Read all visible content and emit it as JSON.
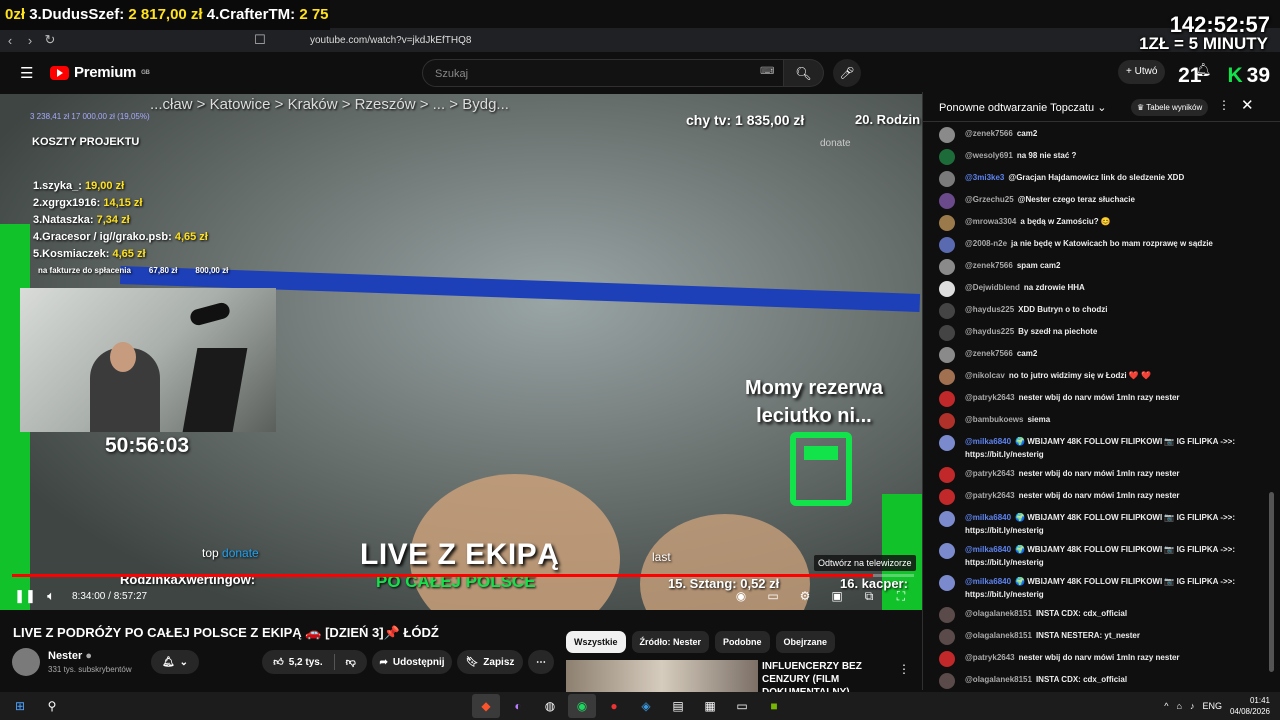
{
  "overlay": {
    "ticker_a": "0zł",
    "ticker_b": "3.DudusSzef:",
    "ticker_c": "2 817,00 zł",
    "ticker_d": "4.CrafterTM:",
    "ticker_e": "2 75",
    "timer": "142:52:57",
    "rate": "1ZŁ = 5 MINUTY",
    "counter_a": "21",
    "counter_b": "39"
  },
  "browser": {
    "url": "youtube.com/watch?v=jkdJkEfTHQ8"
  },
  "header": {
    "logo": "Premium",
    "logo_region": "GB",
    "search_placeholder": "Szukaj",
    "create_label": "Utwó"
  },
  "video": {
    "stream_head": "3 238,41 zł  17 000,00 zł (19,05%)",
    "route": "...cław > Katowice > Kraków > Rzeszów > ... > Bydg...",
    "tv_label": "chy tv: 1 835,00 zł",
    "rodzin": "20. Rodzin",
    "donate_top": "donate",
    "koszty": "KOSZTY PROJEKTU",
    "leaders": [
      {
        "name": "1.szyka_:",
        "amount": "19,00 zł"
      },
      {
        "name": "2.xgrgx1916:",
        "amount": "14,15 zł"
      },
      {
        "name": "3.Nataszka:",
        "amount": "7,34 zł"
      },
      {
        "name": "4.Gracesor / ig//grako.psb:",
        "amount": "4,65 zł"
      },
      {
        "name": "5.Kosmiaczek:",
        "amount": "4,65 zł"
      }
    ],
    "faktura": {
      "label": "na fakturze do spłacenia",
      "a": "67,80 zł",
      "b": "800,00 zł"
    },
    "webcam_clock": "50:56:03",
    "rezerwa": [
      "Momy rezerwa",
      "leciutko ni..."
    ],
    "live": "LIVE Z EKIPĄ",
    "polsce": "PO CAŁEJ POLSCE",
    "top_donate": "top",
    "top_donate_word": "donate",
    "last_donate": "last",
    "rodzinka": "RodzinkaXwertingów:",
    "sztang": "15. Sztang: 0,52 zł",
    "kacper": "16. kacper:",
    "tooltip": "Odtwórz na telewizorze",
    "time": "8:34:00 / 8:57:27",
    "progress": 0.955
  },
  "below": {
    "title": "LIVE Z PODRÓŻY PO CAŁEJ POLSCE Z EKIPĄ 🚗 [DZIEŃ 3]📌 ŁÓDŹ",
    "channel": "Nester",
    "subs": "331 tys. subskrybentów",
    "likes": "5,2 tys.",
    "share": "Udostępnij",
    "save": "Zapisz",
    "chips": [
      "Wszystkie",
      "Źródło: Nester",
      "Podobne",
      "Obejrzane"
    ],
    "related_title": "INFLUENCERZY BEZ CENZURY (FILM DOKUMENTALNY)"
  },
  "chat": {
    "title": "Ponowne odtwarzanie Topczatu",
    "badge": "Tabele wyników",
    "messages": [
      {
        "author": "@zenek7566",
        "text": "cam2",
        "color": "#8a8a8a",
        "mod": false
      },
      {
        "author": "@wesoly691",
        "text": "na 98 nie stać ?",
        "color": "#1e6b3a",
        "mod": false
      },
      {
        "author": "@3mi3ke3",
        "text": "@Gracjan Hajdamowicz link do sledzenie XDD",
        "color": "#7a7a7a",
        "mod": true
      },
      {
        "author": "@Grzechu25",
        "text": "@Nester czego teraz słuchacie",
        "color": "#6a4a8a",
        "mod": false
      },
      {
        "author": "@mrowa3304",
        "text": "a będą w Zamościu? 😊",
        "color": "#9a7a4a",
        "mod": false
      },
      {
        "author": "@2008-n2e",
        "text": "ja nie będę w Katowicach bo mam rozprawę w sądzie",
        "color": "#5a6ab0",
        "mod": false
      },
      {
        "author": "@zenek7566",
        "text": "spam cam2",
        "color": "#8a8a8a",
        "mod": false
      },
      {
        "author": "@Dejwidblend",
        "text": "na zdrowie HHA",
        "color": "#dddddd",
        "mod": false
      },
      {
        "author": "@haydus225",
        "text": "XDD Butryn o to chodzi",
        "color": "#444444",
        "mod": false
      },
      {
        "author": "@haydus225",
        "text": "By szedł na piechote",
        "color": "#444444",
        "mod": false
      },
      {
        "author": "@zenek7566",
        "text": "cam2",
        "color": "#8a8a8a",
        "mod": false
      },
      {
        "author": "@nikolcav",
        "text": "no to jutro widzimy się w Łodzi ❤️ ❤️",
        "color": "#a07050",
        "mod": false
      },
      {
        "author": "@patryk2643",
        "text": "nester wbij do narv mówi 1mln razy nester",
        "color": "#c0282a",
        "mod": false
      },
      {
        "author": "@bambukoews",
        "text": "siema",
        "color": "#b0302a",
        "mod": false
      },
      {
        "author": "@milka6840",
        "text": "🌍 WBIJAMY 48K FOLLOW FILIPKOWI 📷 IG FILIPKA ->>: https://bit.ly/nesterig",
        "color": "#7a8acc",
        "mod": true
      },
      {
        "author": "@patryk2643",
        "text": "nester wbij do narv mówi 1mln razy nester",
        "color": "#c0282a",
        "mod": false
      },
      {
        "author": "@patryk2643",
        "text": "nester wbij do narv mówi 1mln razy nester",
        "color": "#c0282a",
        "mod": false
      },
      {
        "author": "@milka6840",
        "text": "🌍 WBIJAMY 48K FOLLOW FILIPKOWI 📷 IG FILIPKA ->>: https://bit.ly/nesterig",
        "color": "#7a8acc",
        "mod": true
      },
      {
        "author": "@milka6840",
        "text": "🌍 WBIJAMY 48K FOLLOW FILIPKOWI 📷 IG FILIPKA ->>: https://bit.ly/nesterig",
        "color": "#7a8acc",
        "mod": true
      },
      {
        "author": "@milka6840",
        "text": "🌍 WBIJAMY 48K FOLLOW FILIPKOWI 📷 IG FILIPKA ->>: https://bit.ly/nesterig",
        "color": "#7a8acc",
        "mod": true
      },
      {
        "author": "@olagalanek8151",
        "text": "INSTA CDX: cdx_official",
        "color": "#5a4a4a",
        "mod": false
      },
      {
        "author": "@olagalanek8151",
        "text": "INSTA NESTERA: yt_nester",
        "color": "#5a4a4a",
        "mod": false
      },
      {
        "author": "@patryk2643",
        "text": "nester wbij do narv mówi 1mln razy nester",
        "color": "#c0282a",
        "mod": false
      },
      {
        "author": "@olagalanek8151",
        "text": "INSTA CDX: cdx_official",
        "color": "#5a4a4a",
        "mod": false
      }
    ]
  },
  "taskbar": {
    "lang": "ENG",
    "time": "01:41",
    "date": "04/08/2026"
  }
}
